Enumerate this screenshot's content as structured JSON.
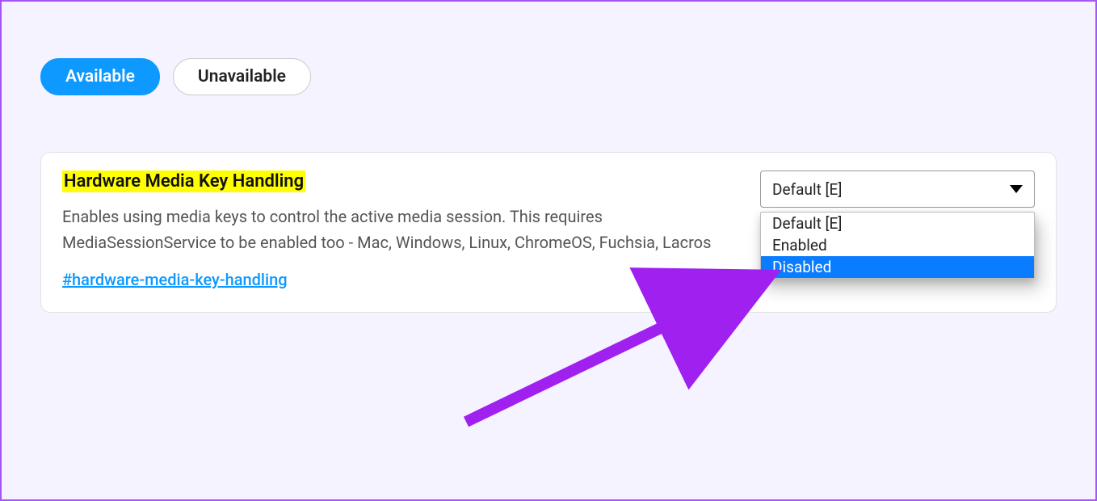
{
  "tabs": {
    "available": "Available",
    "unavailable": "Unavailable"
  },
  "flag": {
    "title": "Hardware Media Key Handling",
    "description": "Enables using media keys to control the active media session. This requires MediaSessionService to be enabled too - Mac, Windows, Linux, ChromeOS, Fuchsia, Lacros",
    "anchor": "#hardware-media-key-handling",
    "selected": "Default [E]",
    "options": {
      "default": "Default [E]",
      "enabled": "Enabled",
      "disabled": "Disabled"
    }
  },
  "annotation": {
    "color": "#a020f0"
  }
}
